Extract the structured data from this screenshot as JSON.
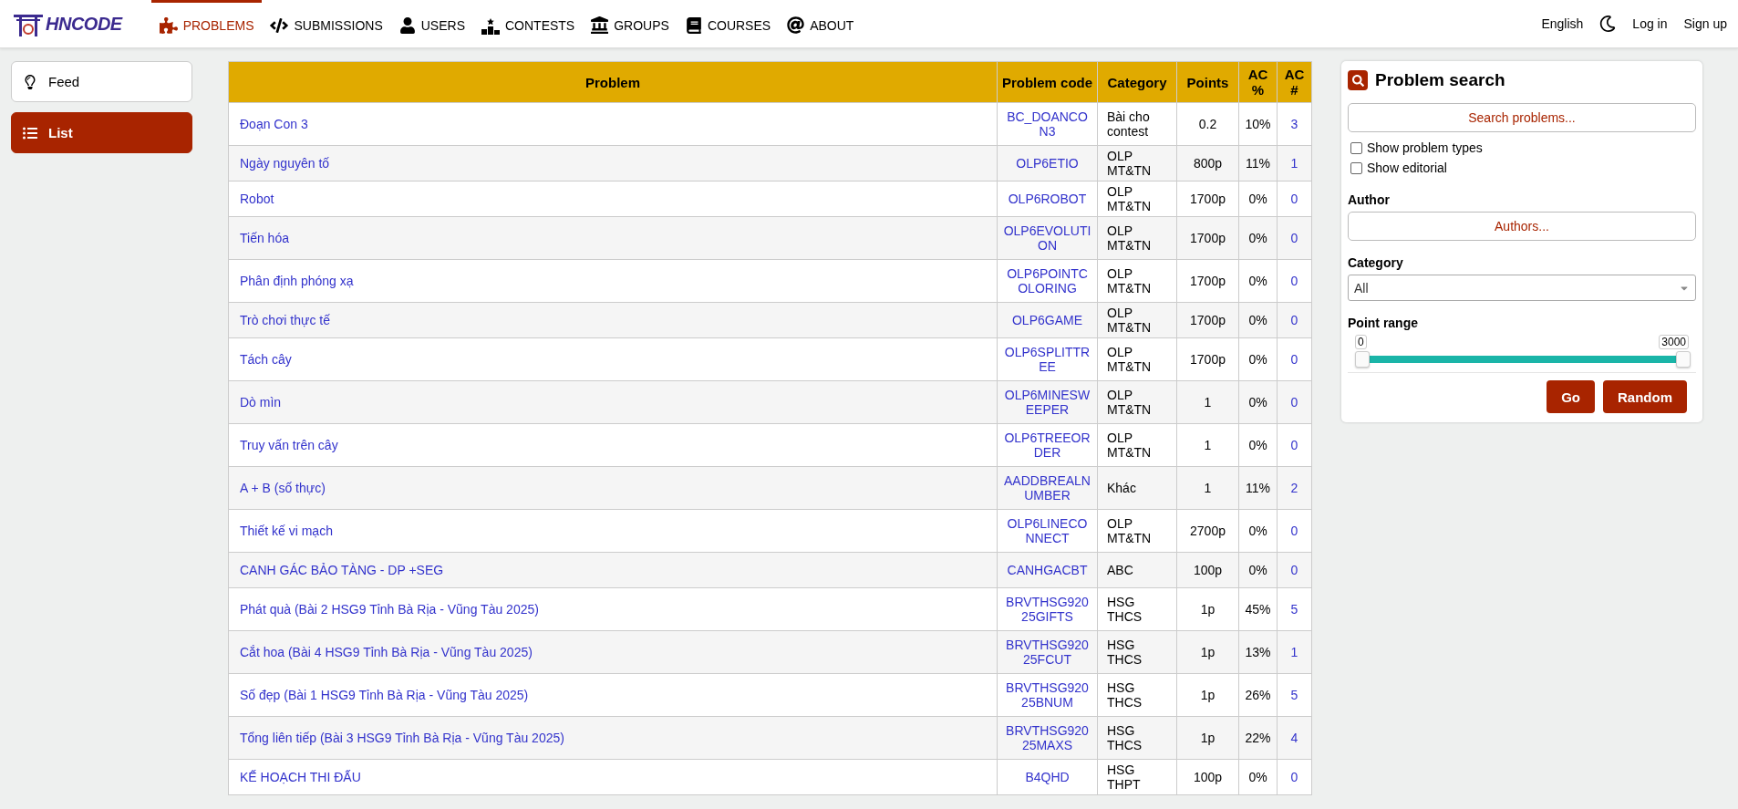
{
  "navbar": {
    "logo": "HNCODE",
    "items": [
      {
        "kind": "puzzle",
        "label": "PROBLEMS",
        "selected": true
      },
      {
        "kind": "code",
        "label": "SUBMISSIONS",
        "selected": false
      },
      {
        "kind": "user",
        "label": "USERS",
        "selected": false
      },
      {
        "kind": "podium",
        "label": "CONTESTS",
        "selected": false
      },
      {
        "kind": "bank",
        "label": "GROUPS",
        "selected": false
      },
      {
        "kind": "book",
        "label": "COURSES",
        "selected": false
      },
      {
        "kind": "at",
        "label": "ABOUT",
        "selected": false
      }
    ],
    "language": "English",
    "login": "Log in",
    "signup": "Sign up"
  },
  "sidebar": {
    "items": [
      {
        "kind": "bulb",
        "label": "Feed",
        "selected": false
      },
      {
        "kind": "list",
        "label": "List",
        "selected": true
      }
    ]
  },
  "table": {
    "columns": [
      "Problem",
      "Problem code",
      "Category",
      "Points",
      "AC %",
      "AC #"
    ],
    "rows": [
      {
        "problem": "Đoạn Con 3",
        "code": "BC_DOANCON3",
        "category": "Bài cho contest",
        "points": "0.2",
        "ac_percent": "10%",
        "ac_count": "3"
      },
      {
        "problem": "Ngày nguyên tố",
        "code": "OLP6ETIO",
        "category": "OLP MT&TN",
        "points": "800p",
        "ac_percent": "11%",
        "ac_count": "1"
      },
      {
        "problem": "Robot",
        "code": "OLP6ROBOT",
        "category": "OLP MT&TN",
        "points": "1700p",
        "ac_percent": "0%",
        "ac_count": "0"
      },
      {
        "problem": "Tiến hóa",
        "code": "OLP6EVOLUTION",
        "category": "OLP MT&TN",
        "points": "1700p",
        "ac_percent": "0%",
        "ac_count": "0"
      },
      {
        "problem": "Phân định phóng xạ",
        "code": "OLP6POINTCOLORING",
        "category": "OLP MT&TN",
        "points": "1700p",
        "ac_percent": "0%",
        "ac_count": "0"
      },
      {
        "problem": "Trò chơi thực tế",
        "code": "OLP6GAME",
        "category": "OLP MT&TN",
        "points": "1700p",
        "ac_percent": "0%",
        "ac_count": "0"
      },
      {
        "problem": "Tách cây",
        "code": "OLP6SPLITTREE",
        "category": "OLP MT&TN",
        "points": "1700p",
        "ac_percent": "0%",
        "ac_count": "0"
      },
      {
        "problem": "Dò mìn",
        "code": "OLP6MINESWEEPER",
        "category": "OLP MT&TN",
        "points": "1",
        "ac_percent": "0%",
        "ac_count": "0"
      },
      {
        "problem": "Truy vấn trên cây",
        "code": "OLP6TREEORDER",
        "category": "OLP MT&TN",
        "points": "1",
        "ac_percent": "0%",
        "ac_count": "0"
      },
      {
        "problem": "A + B (số thực)",
        "code": "AADDBREALNUMBER",
        "category": "Khác",
        "points": "1",
        "ac_percent": "11%",
        "ac_count": "2"
      },
      {
        "problem": "Thiết kế vi mạch",
        "code": "OLP6LINECONNECT",
        "category": "OLP MT&TN",
        "points": "2700p",
        "ac_percent": "0%",
        "ac_count": "0"
      },
      {
        "problem": "CANH GÁC BẢO TÀNG - DP +SEG",
        "code": "CANHGACBT",
        "category": "ABC",
        "points": "100p",
        "ac_percent": "0%",
        "ac_count": "0"
      },
      {
        "problem": "Phát quà (Bài 2 HSG9 Tỉnh Bà Rịa - Vũng Tàu 2025)",
        "code": "BRVTHSG92025GIFTS",
        "category": "HSG THCS",
        "points": "1p",
        "ac_percent": "45%",
        "ac_count": "5"
      },
      {
        "problem": "Cắt hoa (Bài 4 HSG9 Tỉnh Bà Rịa - Vũng Tàu 2025)",
        "code": "BRVTHSG92025FCUT",
        "category": "HSG THCS",
        "points": "1p",
        "ac_percent": "13%",
        "ac_count": "1"
      },
      {
        "problem": "Số đẹp (Bài 1 HSG9 Tỉnh Bà Rịa - Vũng Tàu 2025)",
        "code": "BRVTHSG92025BNUM",
        "category": "HSG THCS",
        "points": "1p",
        "ac_percent": "26%",
        "ac_count": "5"
      },
      {
        "problem": "Tổng liên tiếp (Bài 3 HSG9 Tỉnh Bà Rịa - Vũng Tàu 2025)",
        "code": "BRVTHSG92025MAXS",
        "category": "HSG THCS",
        "points": "1p",
        "ac_percent": "22%",
        "ac_count": "4"
      },
      {
        "problem": "KẾ HOẠCH THI ĐẤU",
        "code": "B4QHD",
        "category": "HSG THPT",
        "points": "100p",
        "ac_percent": "0%",
        "ac_count": "0"
      }
    ]
  },
  "search": {
    "title": "Problem search",
    "placeholder": "Search problems...",
    "checkboxes": [
      {
        "label": "Show problem types",
        "checked": false
      },
      {
        "label": "Show editorial",
        "checked": false
      }
    ],
    "author_label": "Author",
    "author_placeholder": "Authors...",
    "category_label": "Category",
    "category_value": "All",
    "point_range_label": "Point range",
    "range_min": "0",
    "range_max": "3000",
    "range_start": {
      "level": 0
    },
    "range_end": {
      "level": 1
    },
    "buttons": [
      "Go",
      "Random"
    ]
  }
}
